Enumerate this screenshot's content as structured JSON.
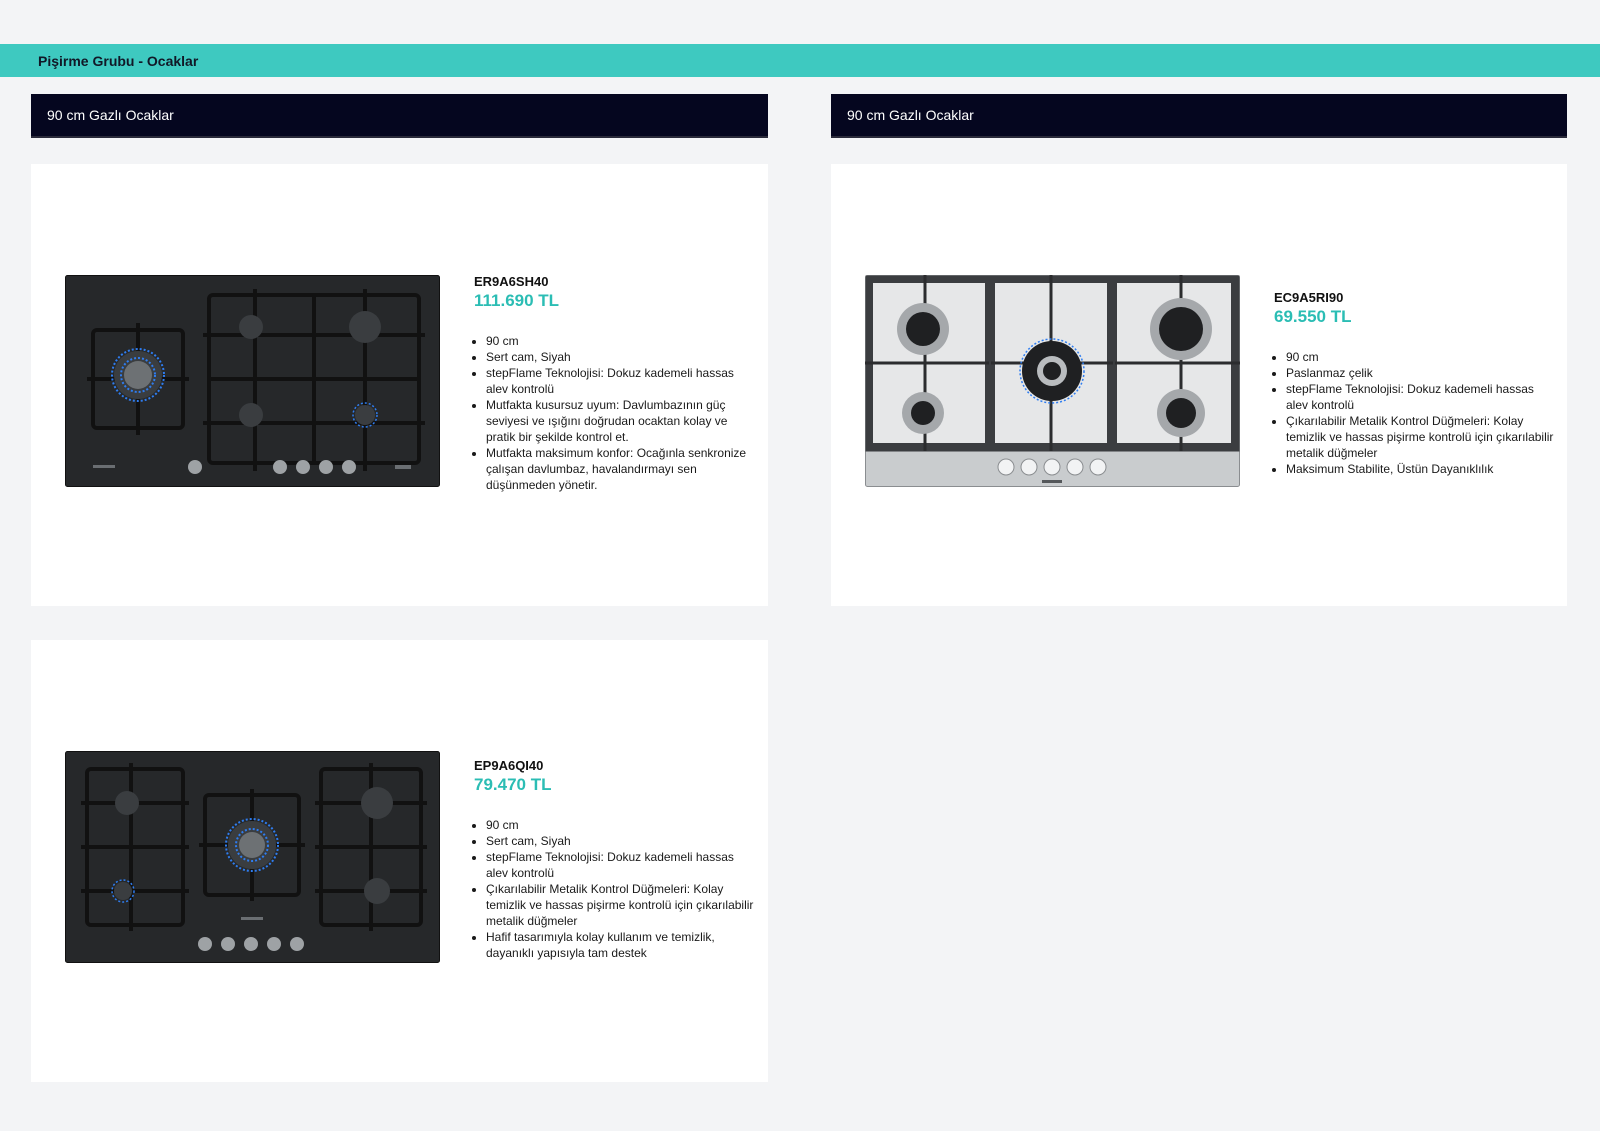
{
  "page_title": "Pişirme Grubu - Ocaklar",
  "sections": [
    {
      "header": "90 cm Gazlı Ocaklar"
    },
    {
      "header": "90 cm Gazlı Ocaklar"
    }
  ],
  "products": [
    {
      "model": "ER9A6SH40",
      "price": "111.690 TL",
      "finish": "black-glass",
      "features": [
        "90 cm",
        "Sert cam, Siyah",
        "stepFlame Teknolojisi: Dokuz kademeli hassas alev kontrolü",
        "Mutfakta kusursuz uyum: Davlumbazının güç seviyesi ve ışığını doğrudan ocaktan kolay ve pratik bir şekilde kontrol et.",
        "Mutfakta maksimum konfor: Ocağınla senkronize çalışan davlumbaz, havalandırmayı sen düşünmeden yönetir."
      ]
    },
    {
      "model": "EC9A5RI90",
      "price": "69.550 TL",
      "finish": "stainless-steel",
      "features": [
        "90 cm",
        "Paslanmaz çelik",
        "stepFlame Teknolojisi: Dokuz kademeli hassas alev kontrolü",
        "Çıkarılabilir Metalik Kontrol Düğmeleri: Kolay temizlik ve hassas pişirme kontrolü için çıkarılabilir metalik düğmeler",
        "Maksimum Stabilite, Üstün Dayanıklılık"
      ]
    },
    {
      "model": "EP9A6QI40",
      "price": "79.470 TL",
      "finish": "black-glass",
      "features": [
        "90 cm",
        "Sert cam, Siyah",
        "stepFlame Teknolojisi: Dokuz kademeli hassas alev kontrolü",
        "Çıkarılabilir Metalik Kontrol Düğmeleri: Kolay temizlik ve hassas pişirme kontrolü için çıkarılabilir metalik düğmeler",
        "Hafif tasarımıyla kolay kullanım ve temizlik, dayanıklı yapısıyla tam destek"
      ]
    }
  ],
  "colors": {
    "accent_bar": "#3ec9c0",
    "price": "#2bbdb4",
    "section_header_bg": "#05061f",
    "page_bg": "#f3f4f6"
  }
}
